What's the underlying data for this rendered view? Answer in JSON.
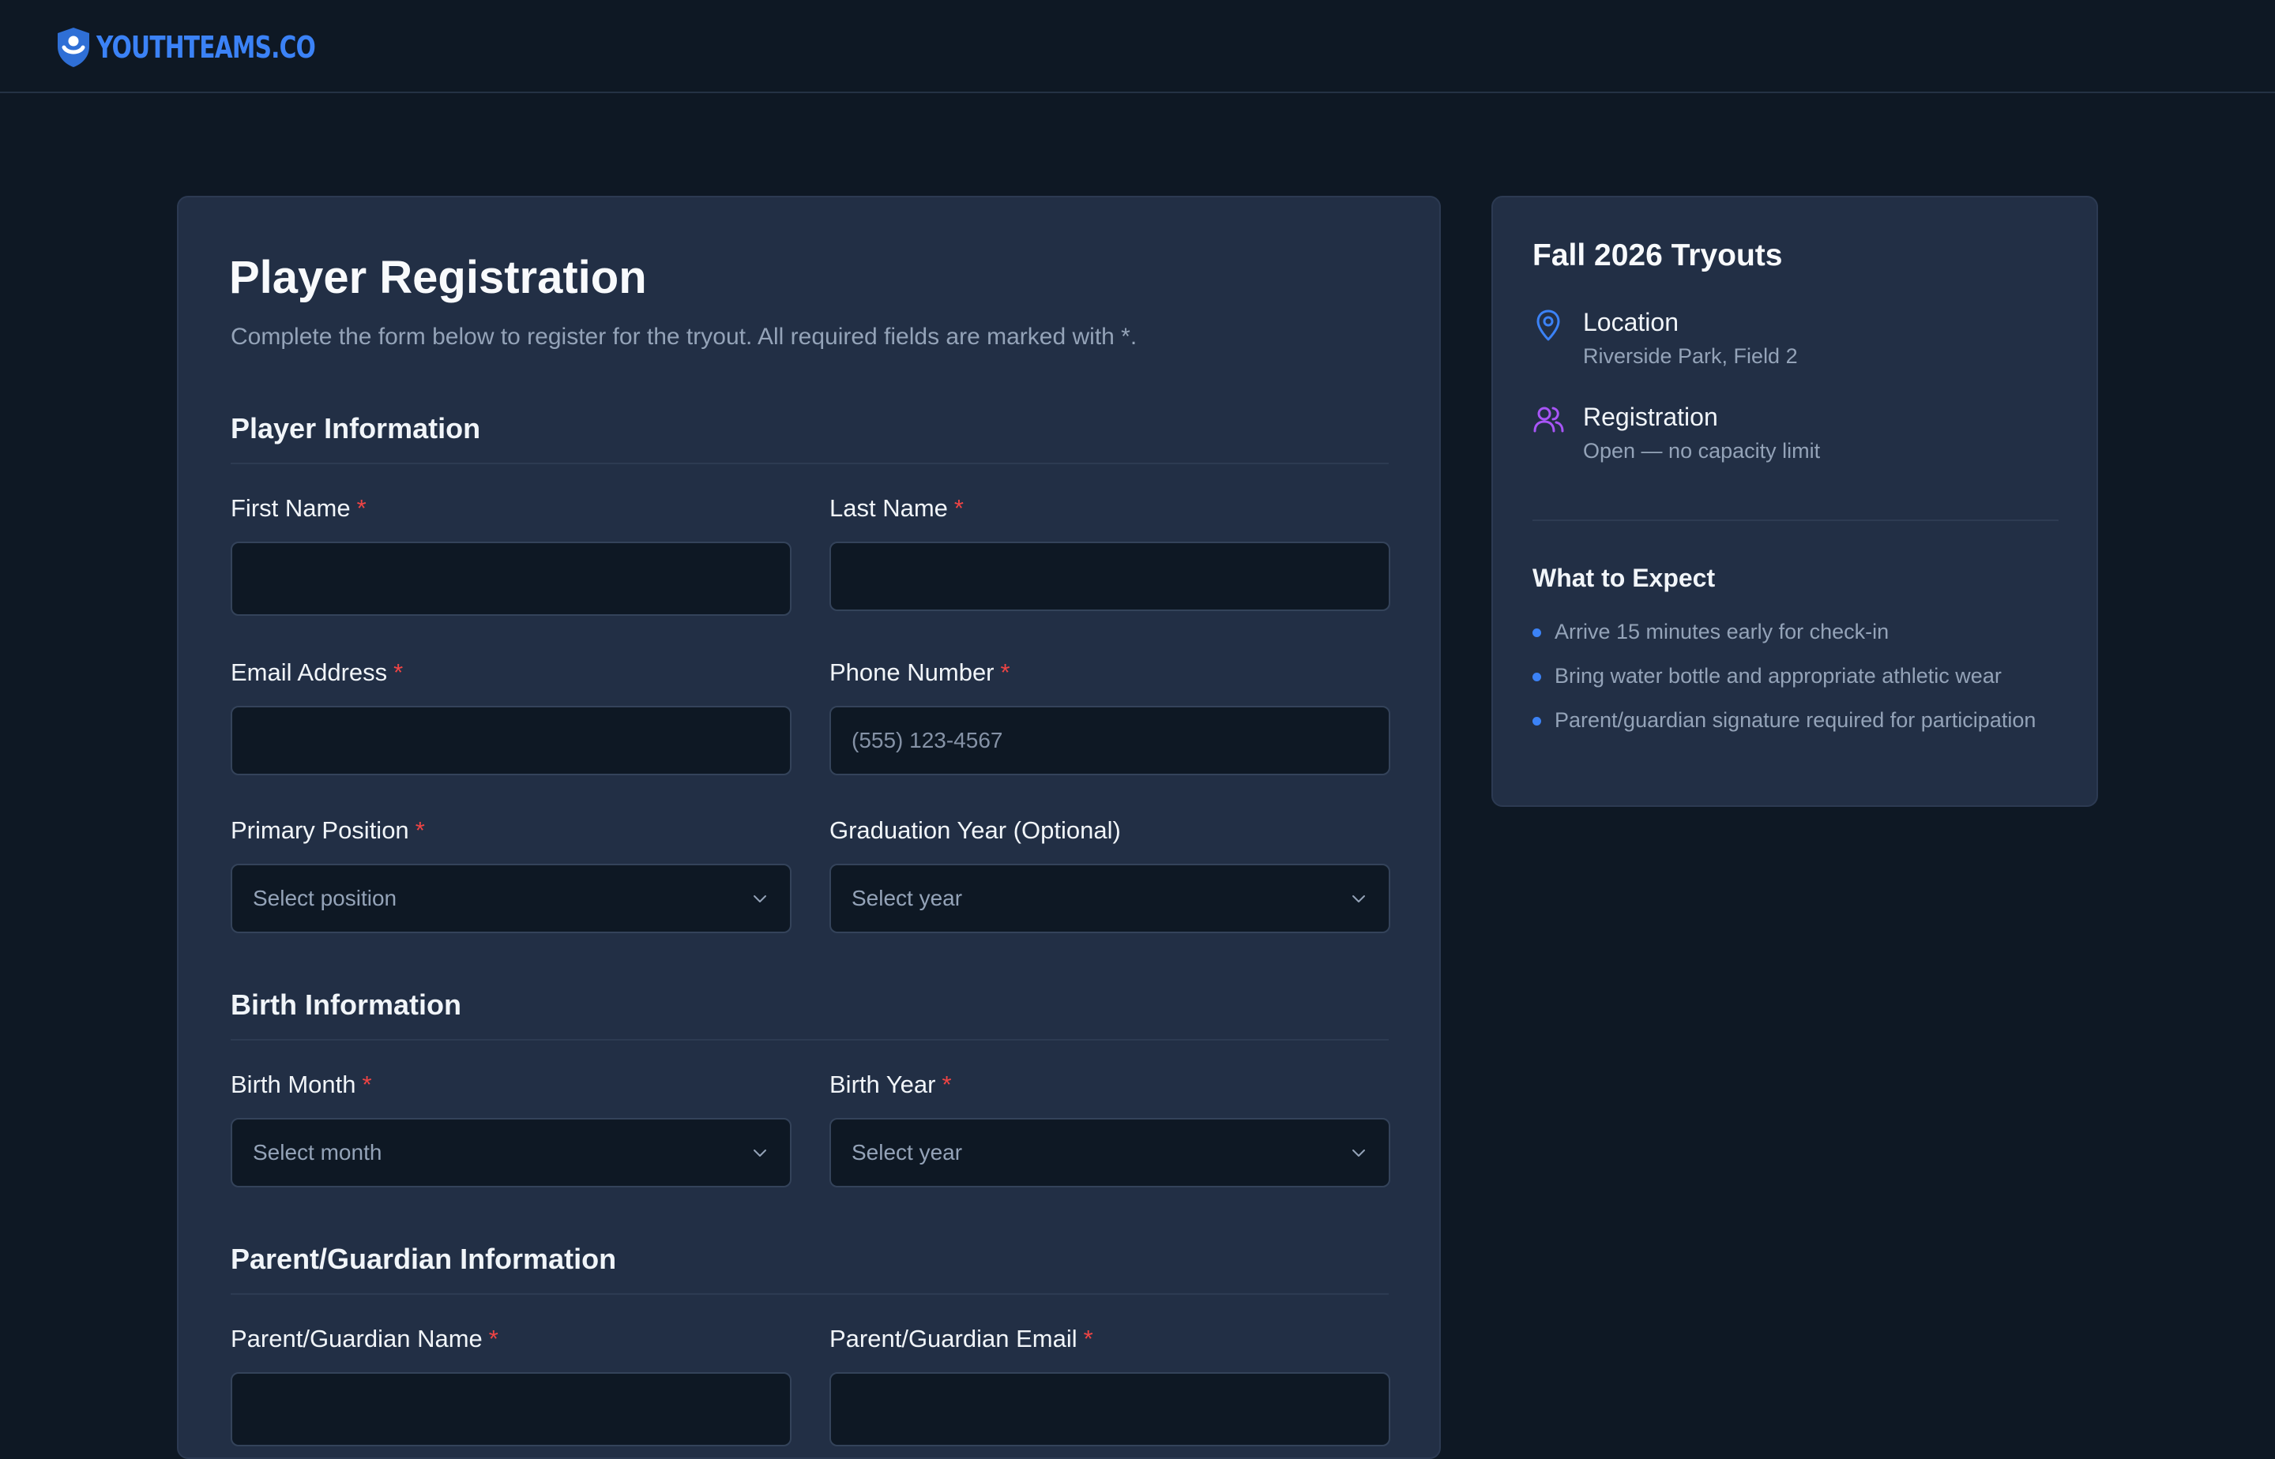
{
  "brand": {
    "name": "YouthTeams.co",
    "color": "#3b82f6",
    "icon": "shield-person-icon"
  },
  "form": {
    "title": "Player Registration",
    "subtitle": "Complete the form below to register for the tryout. All required fields are marked with *.",
    "required_marker": "*",
    "sections": {
      "player": {
        "title": "Player Information",
        "first_name": {
          "label": "First Name",
          "value": "",
          "placeholder": ""
        },
        "last_name": {
          "label": "Last Name",
          "value": "",
          "placeholder": ""
        },
        "email": {
          "label": "Email Address",
          "value": "",
          "placeholder": ""
        },
        "phone": {
          "label": "Phone Number",
          "value": "",
          "placeholder": "(555) 123-4567"
        },
        "position": {
          "label": "Primary Position",
          "selected": "Select position"
        },
        "grad_year": {
          "label": "Graduation Year (Optional)",
          "selected": "Select year"
        }
      },
      "birth": {
        "title": "Birth Information",
        "month": {
          "label": "Birth Month",
          "selected": "Select month"
        },
        "year": {
          "label": "Birth Year",
          "selected": "Select year"
        }
      },
      "guardian": {
        "title": "Parent/Guardian Information",
        "name": {
          "label": "Parent/Guardian Name",
          "value": "",
          "placeholder": ""
        },
        "email": {
          "label": "Parent/Guardian Email",
          "value": "",
          "placeholder": ""
        }
      }
    }
  },
  "event": {
    "title": "Fall 2026 Tryouts",
    "location": {
      "label": "Location",
      "value": "Riverside Park, Field 2",
      "icon": "map-pin-icon",
      "icon_color": "#3b82f6"
    },
    "registration": {
      "label": "Registration",
      "value": "Open — no capacity limit",
      "icon": "users-icon",
      "icon_color": "#a855f7"
    },
    "expect": {
      "title": "What to Expect",
      "items": [
        "Arrive 15 minutes early for check-in",
        "Bring water bottle and appropriate athletic wear",
        "Parent/guardian signature required for participation"
      ]
    }
  },
  "colors": {
    "page_bg": "#0e1824",
    "card_bg": "#222f45",
    "input_bg": "#0e1824",
    "required": "#ef4444",
    "accent": "#3b82f6"
  }
}
